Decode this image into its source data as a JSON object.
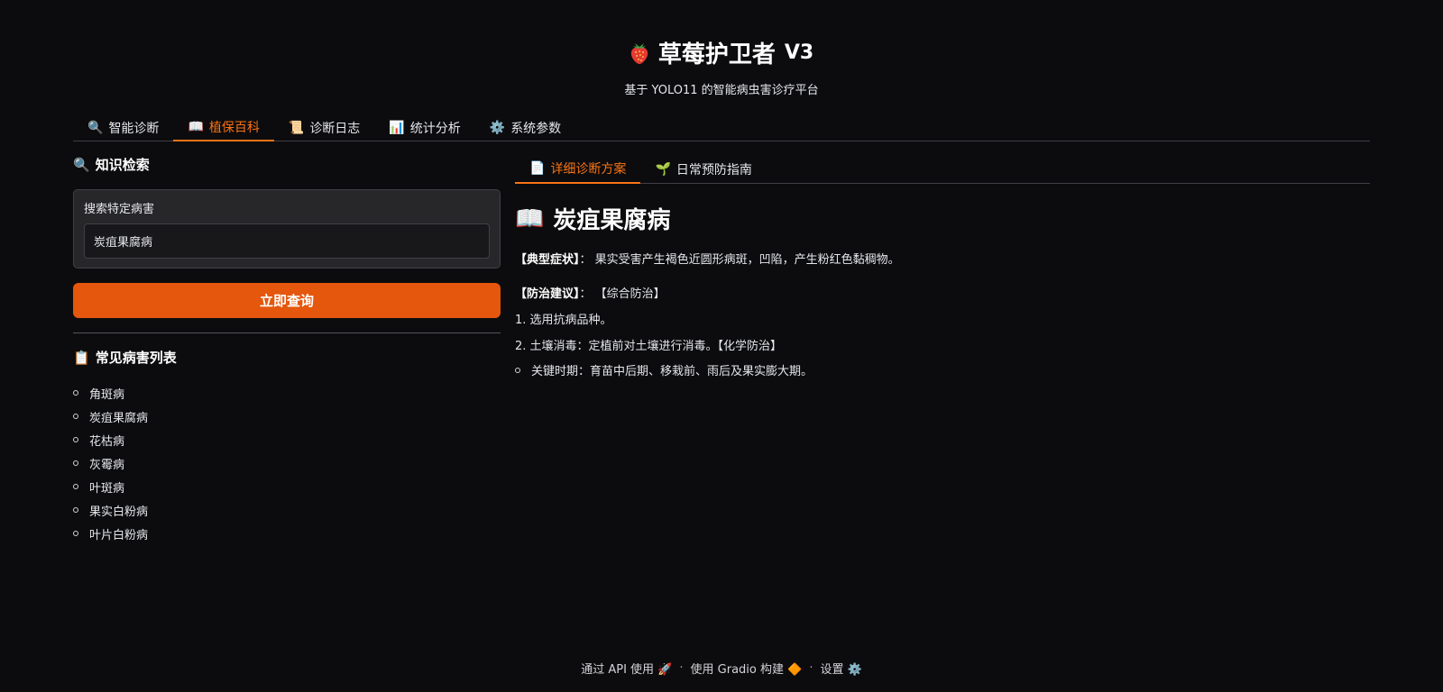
{
  "header": {
    "title": "草莓护卫者",
    "version": "V3",
    "subtitle": "基于 YOLO11 的智能病虫害诊疗平台",
    "logo_icon": "strawberry-icon"
  },
  "main_tabs": [
    {
      "label": "智能诊断",
      "icon": "🔍"
    },
    {
      "label": "植保百科",
      "icon": "📖"
    },
    {
      "label": "诊断日志",
      "icon": "📜"
    },
    {
      "label": "统计分析",
      "icon": "📊"
    },
    {
      "label": "系统参数",
      "icon": "⚙️"
    }
  ],
  "left": {
    "search_section_title": "知识检索",
    "search_icon": "🔍",
    "search_label": "搜索特定病害",
    "search_value": "炭疽果腐病",
    "query_button": "立即查询",
    "list_title": "常见病害列表",
    "list_icon": "📋",
    "diseases": [
      "角斑病",
      "炭疽果腐病",
      "花枯病",
      "灰霉病",
      "叶斑病",
      "果实白粉病",
      "叶片白粉病"
    ]
  },
  "right": {
    "sub_tabs": [
      {
        "label": "详细诊断方案",
        "icon": "📄"
      },
      {
        "label": "日常预防指南",
        "icon": "🌱"
      }
    ],
    "doc_icon": "📖",
    "doc_title": "炭疽果腐病",
    "symptom_label": "【典型症状】",
    "symptom_colon": "：",
    "symptom_text": "果实受害产生褐色近圆形病斑，凹陷，产生粉红色黏稠物。",
    "advice_label": "【防治建议】",
    "advice_colon": "：",
    "advice_text": "【综合防治】",
    "line1": "1. 选用抗病品种。",
    "line2": "2. 土壤消毒：定植前对土壤进行消毒。【化学防治】",
    "bullet_text": "关键时期：育苗中后期、移栽前、雨后及果实膨大期。"
  },
  "footer": {
    "api": "通过 API 使用",
    "api_icon": "🚀",
    "gradio": "使用 Gradio 构建",
    "gradio_icon": "🔶",
    "settings": "设置",
    "settings_icon": "⚙️",
    "separator": "·"
  }
}
